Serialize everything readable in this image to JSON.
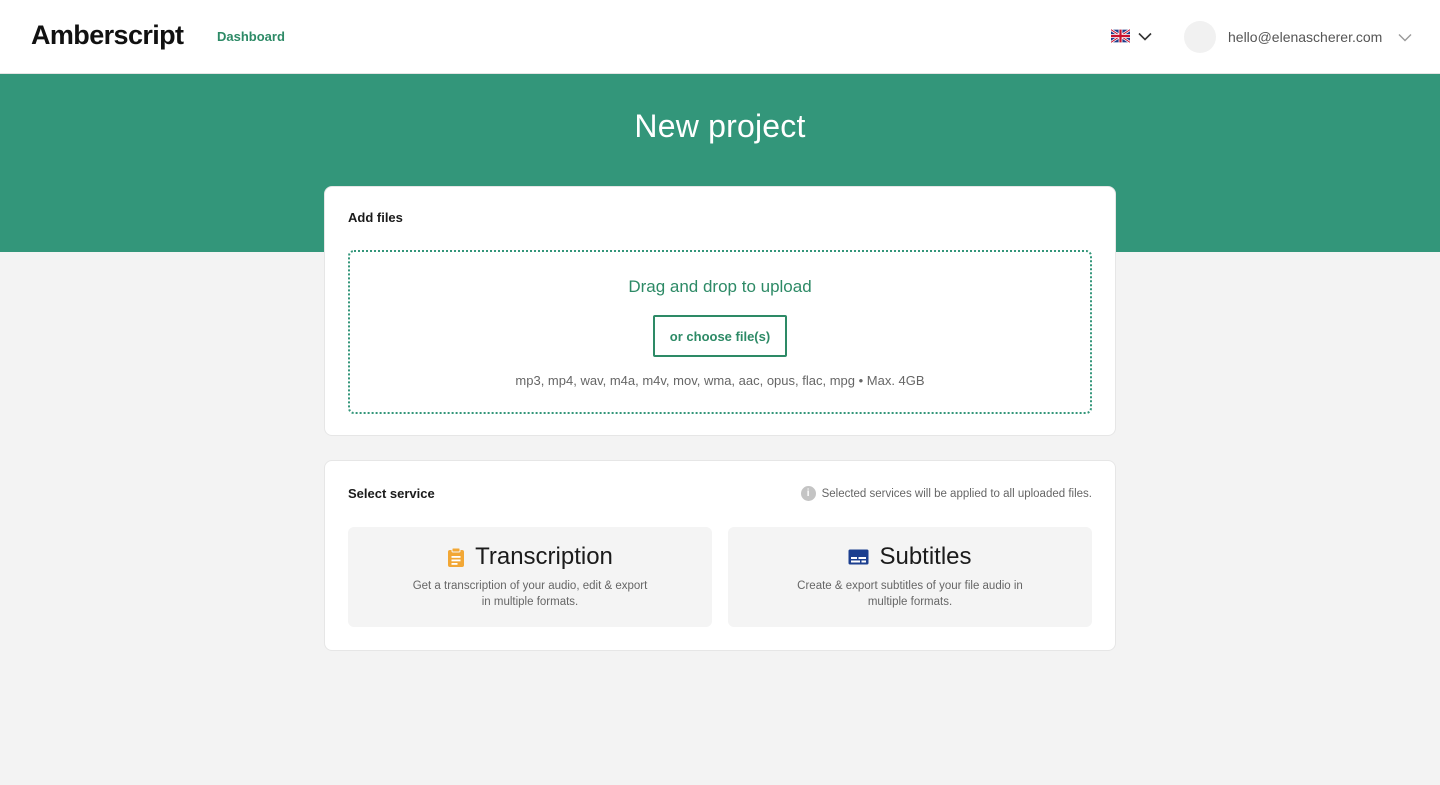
{
  "header": {
    "logo": "Amberscript",
    "nav_dashboard": "Dashboard",
    "language_icon": "uk-flag-icon",
    "user_email": "hello@elenascherer.com"
  },
  "hero": {
    "title": "New project"
  },
  "add_files": {
    "title": "Add files",
    "dropzone_title": "Drag and drop to upload",
    "choose_button": "or choose file(s)",
    "formats": "mp3, mp4, wav, m4a, m4v, mov, wma, aac, opus, flac, mpg • Max. 4GB"
  },
  "select_service": {
    "title": "Select service",
    "info_text": "Selected services will be applied to all uploaded files.",
    "services": [
      {
        "name": "Transcription",
        "description": "Get a transcription of your audio, edit & export in multiple formats.",
        "icon": "clipboard-icon"
      },
      {
        "name": "Subtitles",
        "description": "Create & export subtitles of your file audio in multiple formats.",
        "icon": "subtitles-icon"
      }
    ]
  },
  "colors": {
    "brand_green": "#33967a",
    "link_green": "#2d8a66",
    "transcription_icon": "#f2a735",
    "subtitles_icon": "#1c3f8f",
    "page_background": "#f3f3f3"
  }
}
